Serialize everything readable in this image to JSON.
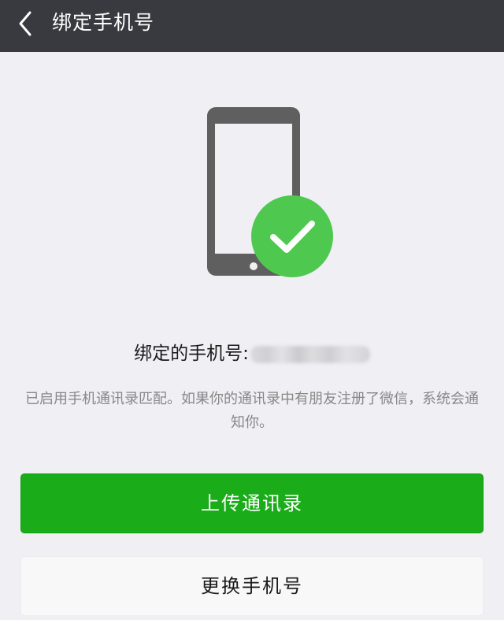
{
  "header": {
    "title": "绑定手机号",
    "back_icon": "chevron-left-icon"
  },
  "illustration": {
    "phone_icon": "smartphone-icon",
    "check_icon": "check-circle-icon",
    "phone_color": "#5f5f5f",
    "check_color": "#4fc84f"
  },
  "bound": {
    "label": "绑定的手机号:"
  },
  "description": "已启用手机通讯录匹配。如果你的通讯录中有朋友注册了微信，系统会通知你。",
  "buttons": {
    "upload_label": "上传通讯录",
    "change_label": "更换手机号"
  },
  "colors": {
    "titlebar": "#393a3f",
    "background": "#efeff4",
    "primary": "#1aad19",
    "secondary": "#f8f8f8"
  }
}
